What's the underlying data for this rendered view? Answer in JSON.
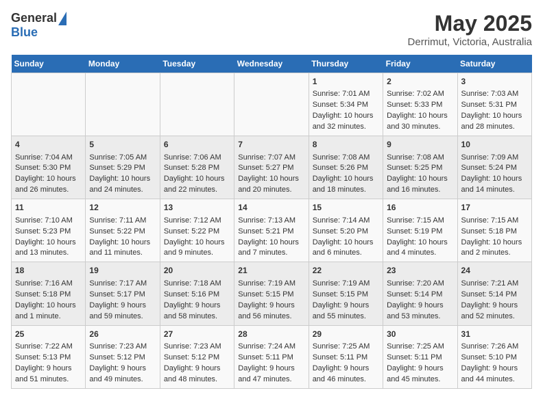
{
  "header": {
    "logo_general": "General",
    "logo_blue": "Blue",
    "title": "May 2025",
    "subtitle": "Derrimut, Victoria, Australia"
  },
  "days_of_week": [
    "Sunday",
    "Monday",
    "Tuesday",
    "Wednesday",
    "Thursday",
    "Friday",
    "Saturday"
  ],
  "weeks": [
    [
      {
        "day": "",
        "data": ""
      },
      {
        "day": "",
        "data": ""
      },
      {
        "day": "",
        "data": ""
      },
      {
        "day": "",
        "data": ""
      },
      {
        "day": "1",
        "data": "Sunrise: 7:01 AM\nSunset: 5:34 PM\nDaylight: 10 hours\nand 32 minutes."
      },
      {
        "day": "2",
        "data": "Sunrise: 7:02 AM\nSunset: 5:33 PM\nDaylight: 10 hours\nand 30 minutes."
      },
      {
        "day": "3",
        "data": "Sunrise: 7:03 AM\nSunset: 5:31 PM\nDaylight: 10 hours\nand 28 minutes."
      }
    ],
    [
      {
        "day": "4",
        "data": "Sunrise: 7:04 AM\nSunset: 5:30 PM\nDaylight: 10 hours\nand 26 minutes."
      },
      {
        "day": "5",
        "data": "Sunrise: 7:05 AM\nSunset: 5:29 PM\nDaylight: 10 hours\nand 24 minutes."
      },
      {
        "day": "6",
        "data": "Sunrise: 7:06 AM\nSunset: 5:28 PM\nDaylight: 10 hours\nand 22 minutes."
      },
      {
        "day": "7",
        "data": "Sunrise: 7:07 AM\nSunset: 5:27 PM\nDaylight: 10 hours\nand 20 minutes."
      },
      {
        "day": "8",
        "data": "Sunrise: 7:08 AM\nSunset: 5:26 PM\nDaylight: 10 hours\nand 18 minutes."
      },
      {
        "day": "9",
        "data": "Sunrise: 7:08 AM\nSunset: 5:25 PM\nDaylight: 10 hours\nand 16 minutes."
      },
      {
        "day": "10",
        "data": "Sunrise: 7:09 AM\nSunset: 5:24 PM\nDaylight: 10 hours\nand 14 minutes."
      }
    ],
    [
      {
        "day": "11",
        "data": "Sunrise: 7:10 AM\nSunset: 5:23 PM\nDaylight: 10 hours\nand 13 minutes."
      },
      {
        "day": "12",
        "data": "Sunrise: 7:11 AM\nSunset: 5:22 PM\nDaylight: 10 hours\nand 11 minutes."
      },
      {
        "day": "13",
        "data": "Sunrise: 7:12 AM\nSunset: 5:22 PM\nDaylight: 10 hours\nand 9 minutes."
      },
      {
        "day": "14",
        "data": "Sunrise: 7:13 AM\nSunset: 5:21 PM\nDaylight: 10 hours\nand 7 minutes."
      },
      {
        "day": "15",
        "data": "Sunrise: 7:14 AM\nSunset: 5:20 PM\nDaylight: 10 hours\nand 6 minutes."
      },
      {
        "day": "16",
        "data": "Sunrise: 7:15 AM\nSunset: 5:19 PM\nDaylight: 10 hours\nand 4 minutes."
      },
      {
        "day": "17",
        "data": "Sunrise: 7:15 AM\nSunset: 5:18 PM\nDaylight: 10 hours\nand 2 minutes."
      }
    ],
    [
      {
        "day": "18",
        "data": "Sunrise: 7:16 AM\nSunset: 5:18 PM\nDaylight: 10 hours\nand 1 minute."
      },
      {
        "day": "19",
        "data": "Sunrise: 7:17 AM\nSunset: 5:17 PM\nDaylight: 9 hours\nand 59 minutes."
      },
      {
        "day": "20",
        "data": "Sunrise: 7:18 AM\nSunset: 5:16 PM\nDaylight: 9 hours\nand 58 minutes."
      },
      {
        "day": "21",
        "data": "Sunrise: 7:19 AM\nSunset: 5:15 PM\nDaylight: 9 hours\nand 56 minutes."
      },
      {
        "day": "22",
        "data": "Sunrise: 7:19 AM\nSunset: 5:15 PM\nDaylight: 9 hours\nand 55 minutes."
      },
      {
        "day": "23",
        "data": "Sunrise: 7:20 AM\nSunset: 5:14 PM\nDaylight: 9 hours\nand 53 minutes."
      },
      {
        "day": "24",
        "data": "Sunrise: 7:21 AM\nSunset: 5:14 PM\nDaylight: 9 hours\nand 52 minutes."
      }
    ],
    [
      {
        "day": "25",
        "data": "Sunrise: 7:22 AM\nSunset: 5:13 PM\nDaylight: 9 hours\nand 51 minutes."
      },
      {
        "day": "26",
        "data": "Sunrise: 7:23 AM\nSunset: 5:12 PM\nDaylight: 9 hours\nand 49 minutes."
      },
      {
        "day": "27",
        "data": "Sunrise: 7:23 AM\nSunset: 5:12 PM\nDaylight: 9 hours\nand 48 minutes."
      },
      {
        "day": "28",
        "data": "Sunrise: 7:24 AM\nSunset: 5:11 PM\nDaylight: 9 hours\nand 47 minutes."
      },
      {
        "day": "29",
        "data": "Sunrise: 7:25 AM\nSunset: 5:11 PM\nDaylight: 9 hours\nand 46 minutes."
      },
      {
        "day": "30",
        "data": "Sunrise: 7:25 AM\nSunset: 5:11 PM\nDaylight: 9 hours\nand 45 minutes."
      },
      {
        "day": "31",
        "data": "Sunrise: 7:26 AM\nSunset: 5:10 PM\nDaylight: 9 hours\nand 44 minutes."
      }
    ]
  ]
}
